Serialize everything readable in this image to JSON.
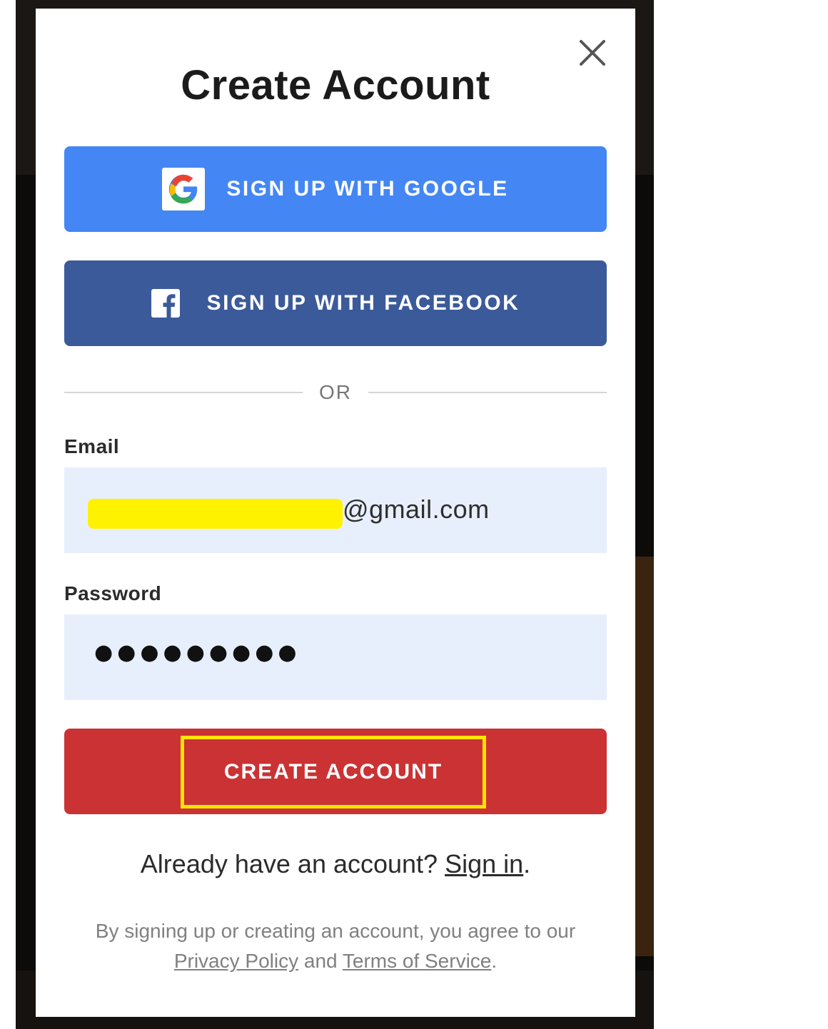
{
  "modal": {
    "title": "Create Account"
  },
  "social": {
    "google_label": "SIGN UP WITH GOOGLE",
    "facebook_label": "SIGN UP WITH FACEBOOK"
  },
  "divider": {
    "text": "OR"
  },
  "form": {
    "email_label": "Email",
    "email_value_visible": "@gmail.com",
    "password_label": "Password",
    "password_masked": "●●●●●●●●●"
  },
  "submit": {
    "label": "CREATE ACCOUNT"
  },
  "signin": {
    "prompt": "Already have an account? ",
    "link": "Sign in",
    "suffix": "."
  },
  "terms": {
    "prefix": "By signing up or creating an account, you agree to our",
    "privacy_link": "Privacy Policy",
    "and": "and",
    "tos_link": "Terms of Service",
    "suffix": "."
  },
  "colors": {
    "google_blue": "#4486f4",
    "facebook_blue": "#3b5a9a",
    "create_red": "#cb3234",
    "input_bg": "#e8effc",
    "highlight_yellow": "#ffe600",
    "redaction_yellow": "#fff200"
  },
  "icons": {
    "close": "close-icon",
    "google": "google-icon",
    "facebook": "facebook-icon"
  }
}
